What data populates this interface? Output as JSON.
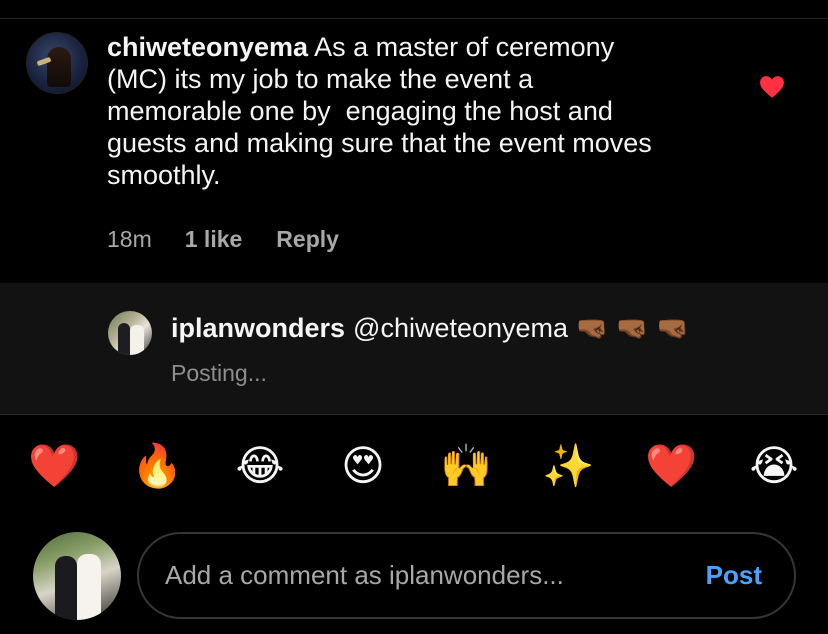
{
  "comment": {
    "username": "chiweteonyema",
    "text": " As a master of ceremony\n(MC) its my job to make the event a\nmemorable one by  engaging the host and\nguests and making sure that the event moves\nsmoothly.",
    "time": "18m",
    "likes": "1 like",
    "reply_label": "Reply",
    "liked": true,
    "heart_color": "#ff3040"
  },
  "reply": {
    "username": "iplanwonders",
    "mention": "@chiweteonyema",
    "emojis": [
      "🤜🏾",
      "🤜🏾",
      "🤜🏾"
    ],
    "status": "Posting..."
  },
  "emoji_bar": [
    {
      "name": "red-heart",
      "glyph": "❤️"
    },
    {
      "name": "fire",
      "glyph": "🔥"
    },
    {
      "name": "tears-of-joy",
      "glyph": "😂"
    },
    {
      "name": "heart-eyes",
      "glyph": "😍"
    },
    {
      "name": "raising-hands",
      "glyph": "🙌"
    },
    {
      "name": "sparkles",
      "glyph": "✨"
    },
    {
      "name": "red-heart",
      "glyph": "❤️"
    },
    {
      "name": "loudly-crying",
      "glyph": "😭"
    }
  ],
  "composer": {
    "placeholder": "Add a comment as iplanwonders...",
    "post_label": "Post"
  }
}
